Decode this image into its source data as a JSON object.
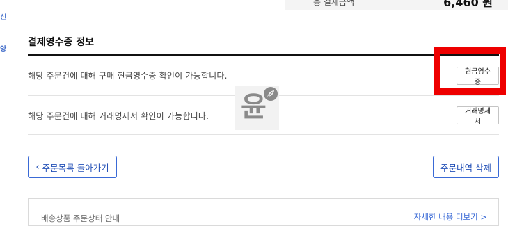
{
  "sidebar": {
    "fragment_1": "신",
    "fragment_2": "앙"
  },
  "total": {
    "label": "총 결제금액",
    "amount": "6,460 원"
  },
  "receipt_section": {
    "title": "결제영수증 정보",
    "rows": [
      {
        "text": "해당 주문건에 대해 구매 현금영수증 확인이 가능합니다.",
        "button": "현금영수증"
      },
      {
        "text": "해당 주문건에 대해 거래명세서 확인이 가능합니다.",
        "button": "거래명세서"
      }
    ]
  },
  "watermark": {
    "char": "윤",
    "icon": "leaf-icon"
  },
  "actions": {
    "back_icon": "chevron-left-icon",
    "back_label": "주문목록 돌아가기",
    "delete_label": "주문내역 삭제"
  },
  "info": {
    "title": "배송상품 주문상태 안내",
    "link": "자세한 내용 더보기 >"
  },
  "colors": {
    "highlight": "#ee0000",
    "accent": "#2451b7"
  }
}
